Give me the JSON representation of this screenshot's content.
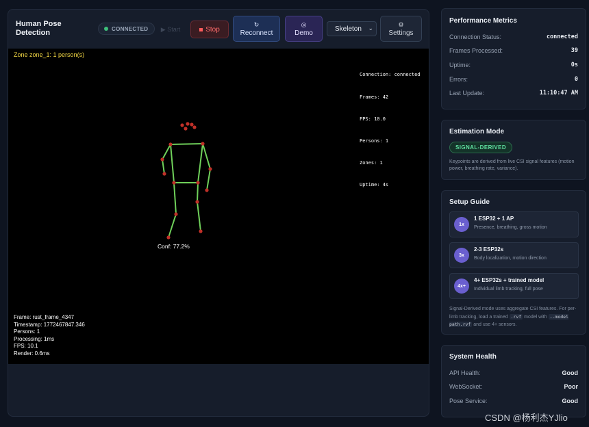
{
  "header": {
    "title": "Human Pose Detection",
    "status_badge": "CONNECTED",
    "start_label": "▶ Start",
    "stop_label": "Stop",
    "reconnect_label": "Reconnect",
    "demo_label": "Demo",
    "mode_select_value": "Skeleton",
    "settings_label": "Settings",
    "accent_colors": {
      "connected": "#3ec07a",
      "stop": "#ff6b6b",
      "reconnect": "#1d2f55",
      "demo": "#2a2555"
    }
  },
  "canvas": {
    "zone_label": "Zone zone_1: 1 person(s)",
    "diagnostics": [
      "Connection: connected",
      "Frames: 42",
      "FPS: 10.0",
      "Persons: 1",
      "Zones: 1",
      "Uptime: 4s"
    ],
    "confidence_label": "Conf: 77.2%",
    "frame_info": [
      "Frame: rust_frame_4347",
      "Timestamp: 1772467847.346",
      "Persons: 1",
      "Processing: 1ms",
      "FPS: 10.1",
      "Render: 0.6ms"
    ]
  },
  "performance": {
    "title": "Performance Metrics",
    "rows": [
      {
        "label": "Connection Status:",
        "value": "connected"
      },
      {
        "label": "Frames Processed:",
        "value": "39"
      },
      {
        "label": "Uptime:",
        "value": "0s"
      },
      {
        "label": "Errors:",
        "value": "0"
      },
      {
        "label": "Last Update:",
        "value": "11:10:47 AM"
      }
    ]
  },
  "estimation": {
    "title": "Estimation Mode",
    "badge": "SIGNAL-DERIVED",
    "description": "Keypoints are derived from live CSI signal features (motion power, breathing rate, variance)."
  },
  "setup": {
    "title": "Setup Guide",
    "cards": [
      {
        "num": "1x",
        "title": "1 ESP32 + 1 AP",
        "sub": "Presence, breathing, gross motion"
      },
      {
        "num": "3x",
        "title": "2-3 ESP32s",
        "sub": "Body localization, motion direction"
      },
      {
        "num": "4x+",
        "title": "4+ ESP32s + trained model",
        "sub": "Individual limb tracking, full pose"
      }
    ],
    "note_1": "Signal-Derived mode uses aggregate CSI features. For per-limb tracking, load a trained",
    "note_code_1": ".rvf",
    "note_2": "model with",
    "note_code_2": "--model path.rvf",
    "note_3": "and use 4+ sensors."
  },
  "health": {
    "title": "System Health",
    "rows": [
      {
        "label": "API Health:",
        "value": "Good"
      },
      {
        "label": "WebSocket:",
        "value": "Poor"
      },
      {
        "label": "Pose Service:",
        "value": "Good"
      }
    ]
  },
  "watermark": "CSDN @杨利杰YJlio"
}
